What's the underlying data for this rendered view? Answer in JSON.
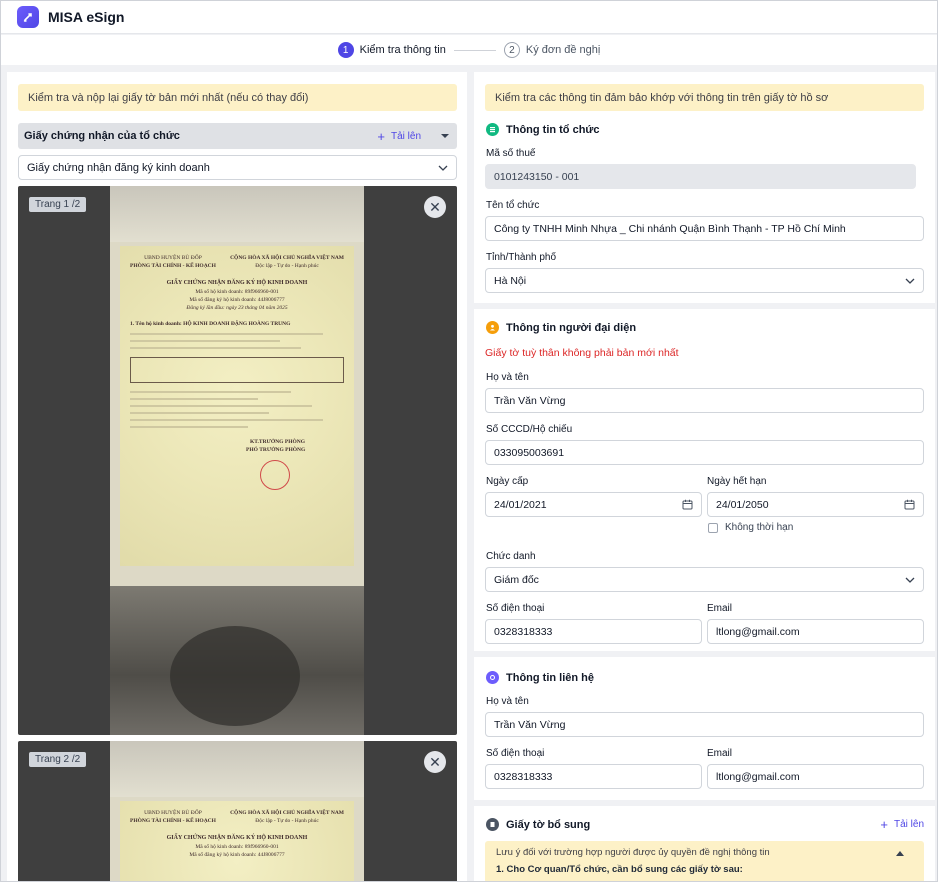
{
  "app": {
    "title": "MISA eSign"
  },
  "stepper": {
    "steps": [
      {
        "num": "1",
        "label": "Kiểm tra thông tin"
      },
      {
        "num": "2",
        "label": "Ký đơn đề nghị"
      }
    ]
  },
  "left": {
    "notice": "Kiểm tra và nộp lại giấy tờ bản mới nhất (nếu có thay đổi)",
    "section_title": "Giấy chứng nhận của tổ chức",
    "upload_label": "Tải lên",
    "doc_type": "Giấy chứng nhận đăng ký kinh doanh",
    "pages": [
      {
        "tag": "Trang 1 /2"
      },
      {
        "tag": "Trang 2 /2"
      }
    ],
    "certificate": {
      "issuer_left_1": "UBND HUYỆN BÙ ĐỐP",
      "issuer_left_2": "PHÒNG TÀI CHÍNH - KẾ HOẠCH",
      "issuer_right_1": "CỘNG HÒA XÃ HỘI CHỦ NGHĨA VIỆT NAM",
      "issuer_right_2": "Độc lập - Tự do - Hạnh phúc",
      "heading": "GIẤY CHỨNG NHẬN ĐĂNG KÝ HỘ KINH DOANH",
      "line_1": "Mã số hộ kinh doanh: 89f966960-001",
      "line_2": "Mã số đăng ký hộ kinh doanh: 44J8006777",
      "line_3": "Đăng ký lần đầu: ngày 23 tháng 04 năm 2025",
      "name_line": "1. Tên hộ kinh doanh: HỘ KINH DOANH ĐẶNG HOÀNG TRUNG",
      "signer_1": "KT.TRƯỞNG PHÒNG",
      "signer_2": "PHÓ TRƯỞNG PHÒNG"
    }
  },
  "right": {
    "notice": "Kiểm tra các thông tin đảm bảo khớp với thông tin trên giấy tờ hồ sơ",
    "org": {
      "title": "Thông tin tổ chức",
      "tax_label": "Mã số thuế",
      "tax_value": "0101243150 - 001",
      "name_label": "Tên tổ chức",
      "name_value": "Công ty TNHH Minh Nhựa _ Chi nhánh Quận Bình Thạnh - TP Hồ Chí Minh",
      "city_label": "Tỉnh/Thành phố",
      "city_value": "Hà Nội"
    },
    "rep": {
      "title": "Thông tin người đại diện",
      "warning": "Giấy tờ tuỳ thân không phải bản mới nhất",
      "fullname_label": "Họ và tên",
      "fullname_value": "Trần Văn Vừng",
      "id_label": "Số CCCD/Hộ chiếu",
      "id_value": "033095003691",
      "issue_label": "Ngày cấp",
      "issue_value": "24/01/2021",
      "expiry_label": "Ngày hết hạn",
      "expiry_value": "24/01/2050",
      "no_expiry_label": "Không thời hạn",
      "position_label": "Chức danh",
      "position_value": "Giám đốc",
      "phone_label": "Số điện thoại",
      "phone_value": "0328318333",
      "email_label": "Email",
      "email_value": "ltlong@gmail.com"
    },
    "contact": {
      "title": "Thông tin liên hệ",
      "fullname_label": "Họ và tên",
      "fullname_value": "Trần Văn Vừng",
      "phone_label": "Số điện thoại",
      "phone_value": "0328318333",
      "email_label": "Email",
      "email_value": "ltlong@gmail.com"
    },
    "extra": {
      "title": "Giấy tờ bổ sung",
      "upload_label": "Tải lên",
      "note_title": "Lưu ý đối với trường hợp người được ủy quyền đề nghị thông tin",
      "note_item_1": "1. Cho Cơ quan/Tổ chức, cần bổ sung các giấy tờ sau:"
    }
  },
  "colors": {
    "accent": "#4f46e5",
    "notice_bg": "#fdf1c7",
    "warning": "#dc2626"
  }
}
